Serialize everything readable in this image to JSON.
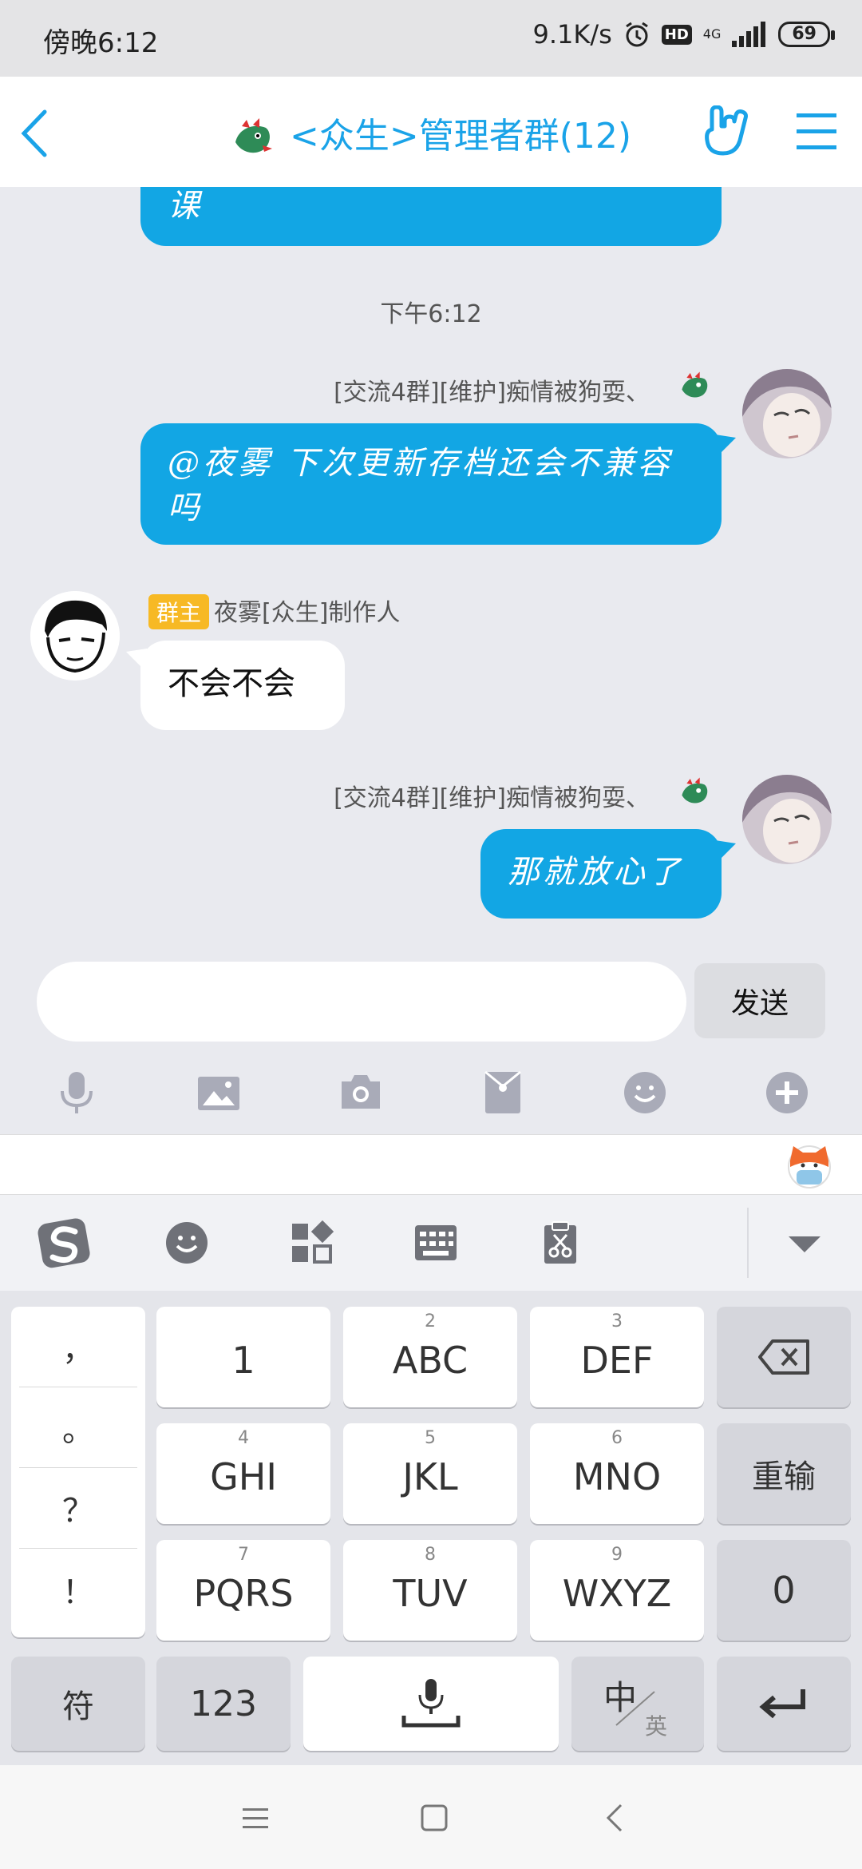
{
  "status_bar": {
    "time": "傍晚6:12",
    "net_speed": "9.1K/s",
    "hd": "HD",
    "signal": "4G",
    "battery": "69"
  },
  "header": {
    "title": "<众生>管理者群(12)"
  },
  "chat": {
    "partial_message": "课",
    "timestamp": "下午6:12",
    "messages": [
      {
        "sender": "[交流4群][维护]痴情被狗耍、",
        "text": "@夜雾 下次更新存档还会不兼容吗"
      },
      {
        "badge": "群主",
        "sender": "夜雾[众生]制作人",
        "text": "不会不会"
      },
      {
        "sender": "[交流4群][维护]痴情被狗耍、",
        "text": "那就放心了"
      }
    ]
  },
  "input": {
    "value": "",
    "send_label": "发送"
  },
  "toolbar": [
    "microphone-icon",
    "image-icon",
    "camera-icon",
    "red-packet-icon",
    "emoji-icon",
    "plus-icon"
  ],
  "ime": {
    "tools": [
      "sogou-logo-icon",
      "emoji-icon",
      "apps-grid-icon",
      "keyboard-icon",
      "clipboard-icon",
      "collapse-icon"
    ]
  },
  "keyboard": {
    "punctuation": [
      "，",
      "。",
      "？",
      "！"
    ],
    "keys": [
      {
        "sub": "",
        "main": "1"
      },
      {
        "sub": "2",
        "main": "ABC"
      },
      {
        "sub": "3",
        "main": "DEF"
      },
      {
        "sub": "4",
        "main": "GHI"
      },
      {
        "sub": "5",
        "main": "JKL"
      },
      {
        "sub": "6",
        "main": "MNO"
      },
      {
        "sub": "7",
        "main": "PQRS"
      },
      {
        "sub": "8",
        "main": "TUV"
      },
      {
        "sub": "9",
        "main": "WXYZ"
      }
    ],
    "retype": "重输",
    "zero": "0",
    "symbol": "符",
    "numbers": "123",
    "lang_main": "中",
    "lang_sub": "英"
  },
  "colors": {
    "accent": "#1aa3e8",
    "bubble": "#12a6e4",
    "badge": "#f7b924"
  }
}
